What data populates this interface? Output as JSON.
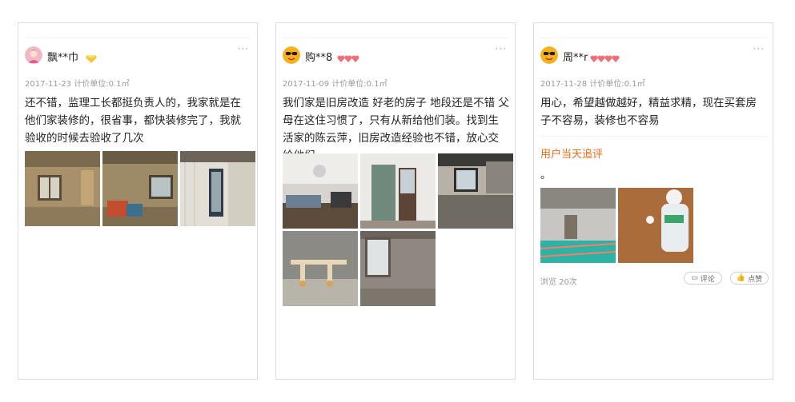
{
  "posts": [
    {
      "user": "飘**巾",
      "avatar": "girl-avatar",
      "badge": "diamond-badge",
      "date": "2017-11-23",
      "unit": "计价单位:0.1㎡",
      "text": "还不错，监理工长都挺负责人的，我家就是在他们家装修的，很省事，都快装修完了，我就验收的时候去验收了几次",
      "photos": 3
    },
    {
      "user": "购**8",
      "avatar": "sunglasses-emoji-avatar",
      "badge": "hearts-badge",
      "date": "2017-11-09",
      "unit": "计价单位:0.1㎡",
      "text": "我们家是旧房改造 好老的房子 地段还是不错 父母在这住习惯了，只有从新给他们装。找到生活家的陈云萍，旧房改造经验也不错，放心交给他们",
      "photos": 5
    },
    {
      "user": "周**r",
      "avatar": "sunglasses-emoji-avatar",
      "badge": "hearts-badge",
      "date": "2017-11-28",
      "unit": "计价单位:0.1㎡",
      "text": "用心，希望越做越好，精益求精，现在买套房子不容易，装修也不容易",
      "review_title": "用户当天追评",
      "review_text": "。",
      "views": "浏览 20次",
      "comment_label": "评论",
      "like_label": "点赞",
      "photos": 2
    }
  ],
  "more_label": "···"
}
